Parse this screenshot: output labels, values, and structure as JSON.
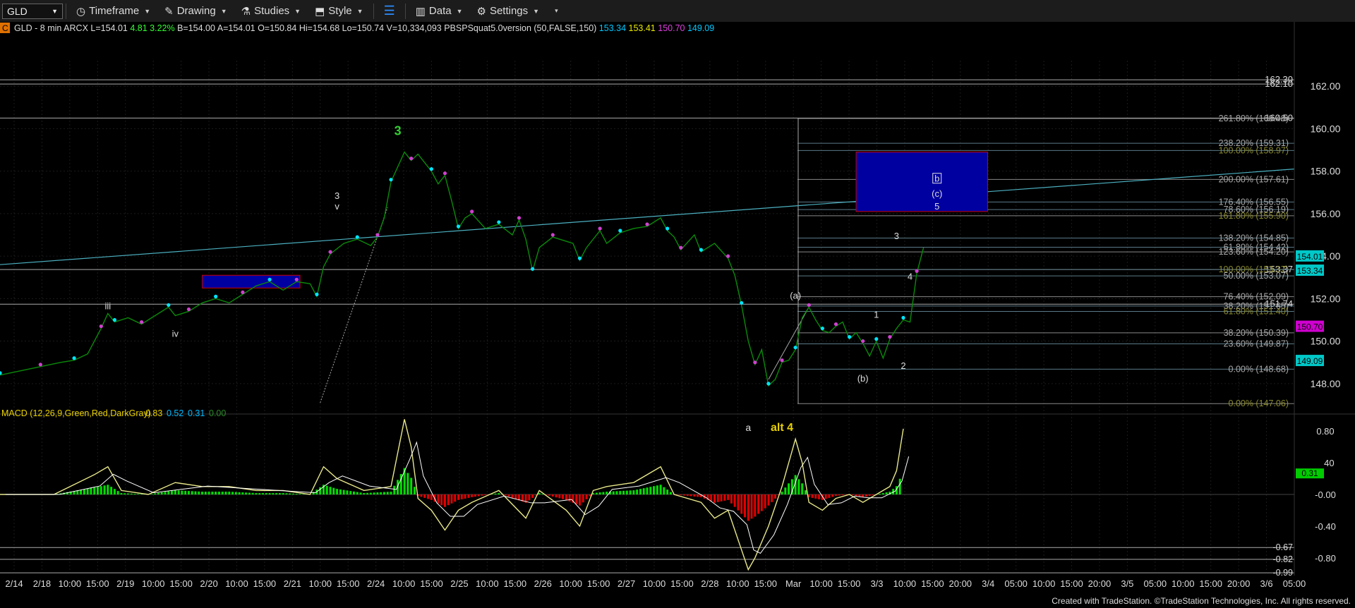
{
  "toolbar": {
    "symbol": "GLD",
    "timeframe": "Timeframe",
    "drawing": "Drawing",
    "studies": "Studies",
    "style": "Style",
    "data": "Data",
    "settings": "Settings"
  },
  "colors": {
    "price_line": "#0a8a0a",
    "dots": "#00e5ff",
    "dots_alt": "#d040d0",
    "trendline": "#4bb0c0",
    "box_blue": "#0000a0",
    "macd": "#e8e88a",
    "signal": "#ffffff",
    "hist_pos": "#00e000",
    "hist_neg": "#e00000",
    "label_green": "#33cc33",
    "label_yellow": "#e8d000"
  },
  "chart_data": {
    "type": "line",
    "title": "GLD - 8 min ARCX",
    "header": {
      "marker": "C",
      "symbol": "GLD - 8 min",
      "exchange": "ARCX",
      "last": "L=154.01",
      "chg": "4.81",
      "pct": "3.22%",
      "bid": "B=154.00",
      "ask": "A=154.01",
      "open": "O=150.84",
      "high": "Hi=154.68",
      "low": "Lo=150.74",
      "vol": "V=10,334,093",
      "study": "PBSPSquat5.0version (50,FALSE,150)",
      "v1": "153.34",
      "v2": "153.41",
      "v3": "150.70",
      "v4": "149.09"
    },
    "x_ticks": [
      "2/14",
      "2/18",
      "10:00",
      "15:00",
      "2/19",
      "10:00",
      "15:00",
      "2/20",
      "10:00",
      "15:00",
      "2/21",
      "10:00",
      "15:00",
      "2/24",
      "10:00",
      "15:00",
      "2/25",
      "10:00",
      "15:00",
      "2/26",
      "10:00",
      "15:00",
      "2/27",
      "10:00",
      "15:00",
      "2/28",
      "10:00",
      "15:00",
      "Mar",
      "10:00",
      "15:00",
      "3/3",
      "10:00",
      "15:00",
      "20:00",
      "3/4",
      "05:00",
      "10:00",
      "15:00",
      "20:00",
      "3/5",
      "05:00",
      "10:00",
      "15:00",
      "20:00",
      "3/6",
      "05:00"
    ],
    "y_ticks": [
      "148.00",
      "150.00",
      "152.00",
      "154.00",
      "156.00",
      "158.00",
      "160.00",
      "162.00"
    ],
    "ylim": [
      147.1,
      163.2
    ],
    "price_series": [
      [
        0,
        148.4
      ],
      [
        3,
        148.6
      ],
      [
        6,
        148.8
      ],
      [
        9,
        149.0
      ],
      [
        11,
        149.1
      ],
      [
        13,
        149.4
      ],
      [
        15,
        150.6
      ],
      [
        16,
        151.3
      ],
      [
        17,
        150.9
      ],
      [
        19,
        151.1
      ],
      [
        21,
        150.8
      ],
      [
        23,
        151.2
      ],
      [
        25,
        151.6
      ],
      [
        26,
        151.2
      ],
      [
        28,
        151.4
      ],
      [
        30,
        151.8
      ],
      [
        32,
        152.0
      ],
      [
        34,
        151.8
      ],
      [
        36,
        152.2
      ],
      [
        38,
        152.6
      ],
      [
        40,
        152.8
      ],
      [
        42,
        152.4
      ],
      [
        44,
        152.8
      ],
      [
        46,
        152.7
      ],
      [
        47,
        152.1
      ],
      [
        48,
        153.5
      ],
      [
        49,
        154.1
      ],
      [
        51,
        154.6
      ],
      [
        53,
        154.8
      ],
      [
        55,
        154.5
      ],
      [
        56,
        154.9
      ],
      [
        57,
        155.8
      ],
      [
        58,
        157.5
      ],
      [
        60,
        158.9
      ],
      [
        61,
        158.5
      ],
      [
        62,
        158.8
      ],
      [
        64,
        158.0
      ],
      [
        65,
        157.4
      ],
      [
        66,
        157.8
      ],
      [
        67,
        156.6
      ],
      [
        68,
        155.3
      ],
      [
        69,
        155.8
      ],
      [
        70,
        156.0
      ],
      [
        72,
        155.3
      ],
      [
        74,
        155.5
      ],
      [
        76,
        155.0
      ],
      [
        77,
        155.7
      ],
      [
        78,
        154.8
      ],
      [
        79,
        153.3
      ],
      [
        80,
        154.4
      ],
      [
        82,
        154.9
      ],
      [
        85,
        154.6
      ],
      [
        86,
        153.8
      ],
      [
        87,
        154.4
      ],
      [
        89,
        155.2
      ],
      [
        90,
        154.6
      ],
      [
        92,
        155.1
      ],
      [
        94,
        155.3
      ],
      [
        96,
        155.4
      ],
      [
        98,
        155.8
      ],
      [
        99,
        155.2
      ],
      [
        100,
        154.9
      ],
      [
        101,
        154.3
      ],
      [
        103,
        155.0
      ],
      [
        104,
        154.2
      ],
      [
        106,
        154.6
      ],
      [
        108,
        153.9
      ],
      [
        109,
        153.1
      ],
      [
        110,
        151.7
      ],
      [
        111,
        150.0
      ],
      [
        112,
        148.9
      ],
      [
        113,
        149.6
      ],
      [
        114,
        147.9
      ],
      [
        115,
        148.2
      ],
      [
        116,
        149.0
      ],
      [
        117,
        149.1
      ],
      [
        118,
        149.6
      ],
      [
        119,
        151.1
      ],
      [
        120,
        151.6
      ],
      [
        121,
        151.0
      ],
      [
        122,
        150.5
      ],
      [
        123,
        150.4
      ],
      [
        124,
        150.7
      ],
      [
        125,
        150.9
      ],
      [
        126,
        150.1
      ],
      [
        127,
        150.4
      ],
      [
        128,
        149.9
      ],
      [
        129,
        149.3
      ],
      [
        130,
        150.0
      ],
      [
        131,
        149.2
      ],
      [
        132,
        150.1
      ],
      [
        133,
        150.6
      ],
      [
        134,
        151.0
      ],
      [
        135,
        150.9
      ],
      [
        136,
        153.2
      ],
      [
        137,
        154.4
      ]
    ],
    "horizontal_levels": [
      {
        "value": "162.30",
        "price": 162.3
      },
      {
        "value": "162.10",
        "price": 162.1
      },
      {
        "value": "160.50",
        "price": 160.5
      },
      {
        "value": "153.37",
        "price": 153.37
      },
      {
        "value": "151.74",
        "price": 151.74
      }
    ],
    "fib_levels": [
      {
        "label": "261.80% (160.48)",
        "price": 160.48
      },
      {
        "label": "238.20% (159.31)",
        "price": 159.31
      },
      {
        "label": "100.00% (158.97)",
        "price": 158.97
      },
      {
        "label": "200.00% (157.61)",
        "price": 157.61
      },
      {
        "label": "176.40% (156.55)",
        "price": 156.55
      },
      {
        "label": "78.60% (156.19)",
        "price": 156.19
      },
      {
        "label": "161.80% (155.90)",
        "price": 155.9
      },
      {
        "label": "138.20% (154.85)",
        "price": 154.85
      },
      {
        "label": "61.80% (154.42)",
        "price": 154.42
      },
      {
        "label": "123.60% (154.20)",
        "price": 154.2
      },
      {
        "label": "100.00% (153.37)",
        "price": 153.37
      },
      {
        "label": "50.00% (153.07)",
        "price": 153.07
      },
      {
        "label": "76.40% (152.09)",
        "price": 152.09
      },
      {
        "label": "38.20% (151.65)",
        "price": 151.65
      },
      {
        "label": "61.80% (151.40)",
        "price": 151.4
      },
      {
        "label": "38.20% (150.39)",
        "price": 150.39
      },
      {
        "label": "23.60% (149.87)",
        "price": 149.87
      },
      {
        "label": "0.00% (148.68)",
        "price": 148.68
      },
      {
        "label": "0.00% (147.06)",
        "price": 147.06
      }
    ],
    "price_tags": [
      {
        "text": "154.01",
        "price": 154.01,
        "bg": "#00c8c8"
      },
      {
        "text": "153.34",
        "price": 153.34,
        "bg": "#00c8c8"
      },
      {
        "text": "150.70",
        "price": 150.7,
        "bg": "#d000d0"
      },
      {
        "text": "149.09",
        "price": 149.09,
        "bg": "#00c8c8"
      }
    ],
    "wave_labels": [
      {
        "text": "3",
        "x": 59,
        "price": 159.7,
        "color": "#33cc33",
        "bold": true,
        "size": 18
      },
      {
        "text": "iii",
        "x": 16,
        "price": 151.5,
        "color": "#dddddd"
      },
      {
        "text": "iv",
        "x": 26,
        "price": 150.2,
        "color": "#dddddd"
      },
      {
        "text": "3",
        "x": 50,
        "price": 156.7,
        "color": "#dddddd"
      },
      {
        "text": "v",
        "x": 50,
        "price": 156.2,
        "color": "#dddddd"
      },
      {
        "text": "(a)",
        "x": 118,
        "price": 152.0,
        "color": "#dddddd"
      },
      {
        "text": "(b)",
        "x": 128,
        "price": 148.1,
        "color": "#dddddd"
      },
      {
        "text": "1",
        "x": 130,
        "price": 151.1,
        "color": "#dddddd"
      },
      {
        "text": "2",
        "x": 134,
        "price": 148.7,
        "color": "#dddddd"
      },
      {
        "text": "3",
        "x": 133,
        "price": 154.8,
        "color": "#dddddd"
      },
      {
        "text": "4",
        "x": 135,
        "price": 152.9,
        "color": "#dddddd"
      },
      {
        "text": "b",
        "x": 139,
        "price": 157.5,
        "color": "#dddddd",
        "boxed": true
      },
      {
        "text": "(c)",
        "x": 139,
        "price": 156.8,
        "color": "#dddddd"
      },
      {
        "text": "5",
        "x": 139,
        "price": 156.2,
        "color": "#dddddd"
      }
    ],
    "target_box": {
      "x0": 127,
      "x1": 146.5,
      "p0": 156.1,
      "p1": 158.9
    },
    "small_box": {
      "x0": 30,
      "x1": 44.5,
      "p0": 152.5,
      "p1": 153.1
    },
    "trendline": {
      "x0": 0,
      "p0": 153.6,
      "x1": 192,
      "p1": 158.1
    },
    "macd": {
      "title": "MACD (12,26,9,Green,Red,DarkGray)",
      "values": [
        "0.83",
        "0.52",
        "0.31",
        "0.00"
      ],
      "value_colors": [
        "#e8d000",
        "#00bbff",
        "#00bbff",
        "#2a8a2a"
      ],
      "y_ticks": [
        "0.80",
        "0.40",
        "-0.00",
        "-0.40",
        "-0.80"
      ],
      "ylim": [
        -0.98,
        0.98
      ],
      "extra_levels": [
        "-0.67",
        "-0.82",
        "-0.99"
      ],
      "extra_level_values": [
        -0.67,
        -0.82,
        -0.99
      ],
      "current_tag": "0.31",
      "current_tag2": "0.40",
      "annotations": [
        {
          "text": "a",
          "x": 111,
          "color": "#dddddd"
        },
        {
          "text": "alt 4",
          "x": 116,
          "color": "#e8d000",
          "bold": true
        }
      ],
      "series": [
        [
          0,
          0.0
        ],
        [
          8,
          0.0
        ],
        [
          14,
          0.25
        ],
        [
          16,
          0.35
        ],
        [
          18,
          0.05
        ],
        [
          22,
          0.0
        ],
        [
          26,
          0.15
        ],
        [
          30,
          0.1
        ],
        [
          34,
          0.1
        ],
        [
          38,
          0.05
        ],
        [
          42,
          0.05
        ],
        [
          46,
          0.0
        ],
        [
          48,
          0.35
        ],
        [
          50,
          0.2
        ],
        [
          54,
          0.05
        ],
        [
          58,
          0.1
        ],
        [
          60,
          0.95
        ],
        [
          61,
          0.6
        ],
        [
          62,
          -0.05
        ],
        [
          64,
          -0.2
        ],
        [
          66,
          -0.45
        ],
        [
          68,
          -0.2
        ],
        [
          70,
          -0.1
        ],
        [
          74,
          0.05
        ],
        [
          78,
          -0.3
        ],
        [
          80,
          0.05
        ],
        [
          84,
          -0.2
        ],
        [
          86,
          -0.4
        ],
        [
          88,
          0.05
        ],
        [
          90,
          0.1
        ],
        [
          94,
          0.15
        ],
        [
          98,
          0.35
        ],
        [
          100,
          0.0
        ],
        [
          104,
          -0.1
        ],
        [
          106,
          -0.3
        ],
        [
          108,
          -0.2
        ],
        [
          110,
          -0.7
        ],
        [
          111,
          -0.95
        ],
        [
          112,
          -0.8
        ],
        [
          114,
          -0.4
        ],
        [
          116,
          0.1
        ],
        [
          118,
          0.7
        ],
        [
          119,
          0.4
        ],
        [
          120,
          -0.1
        ],
        [
          122,
          -0.2
        ],
        [
          124,
          -0.05
        ],
        [
          126,
          0.0
        ],
        [
          128,
          -0.1
        ],
        [
          130,
          0.0
        ],
        [
          132,
          0.1
        ],
        [
          133,
          0.3
        ],
        [
          134,
          0.83
        ]
      ]
    }
  },
  "footer": "Created with TradeStation. ©TradeStation Technologies, Inc. All rights reserved."
}
